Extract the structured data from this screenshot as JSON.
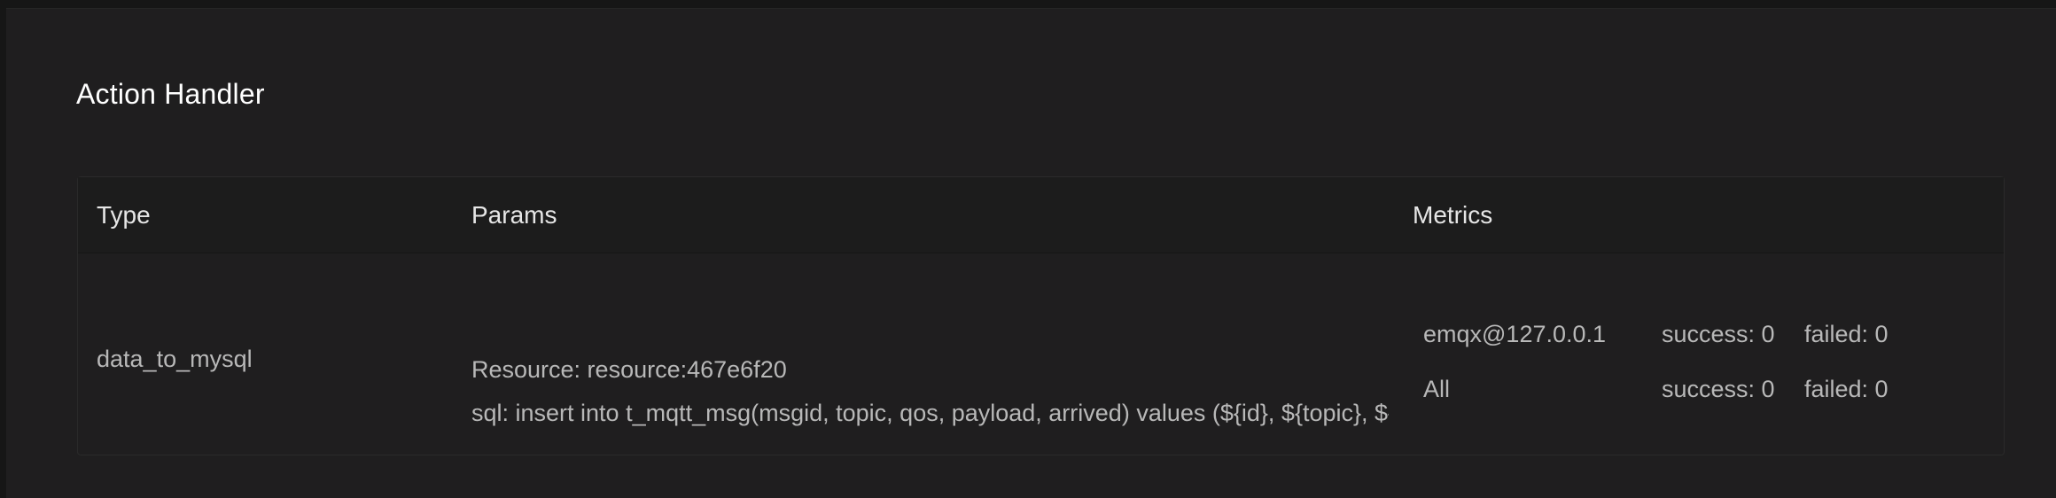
{
  "section": {
    "title": "Action Handler"
  },
  "table": {
    "columns": [
      "Type",
      "Params",
      "Metrics"
    ],
    "row": {
      "type": "data_to_mysql",
      "params": {
        "resource": "Resource: resource:467e6f20",
        "sql": "sql: insert into t_mqtt_msg(msgid, topic, qos, payload, arrived) values (${id}, ${topic}, ${qos}, ${payload}, ${timestamp})"
      },
      "metrics": [
        {
          "node": "emqx@127.0.0.1",
          "success": "success: 0",
          "failed": "failed: 0"
        },
        {
          "node": "All",
          "success": "success: 0",
          "failed": "failed: 0"
        }
      ]
    }
  }
}
